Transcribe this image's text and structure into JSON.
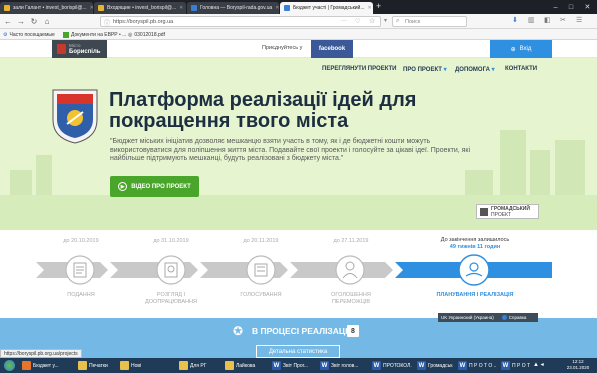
{
  "browser": {
    "tabs": [
      {
        "label": "зали Галант • invest_borispil@...",
        "color": "#e8b42b",
        "active": false
      },
      {
        "label": "Входящие • invest_borispil@...",
        "color": "#e8b42b",
        "active": false
      },
      {
        "label": "Головна — Boryspil-rada.gov.ua",
        "color": "#3b7fd4",
        "active": false
      },
      {
        "label": "Бюджет участі | Громадський...",
        "color": "#3b7fd4",
        "active": true
      }
    ],
    "new_tab": "+",
    "url": "https://boryspil.pb.org.ua",
    "search_placeholder": "Поиск",
    "bookmarks": [
      "Часто посещаемые",
      "Документи на ЕВРР • ...",
      "03012018.pdf"
    ]
  },
  "header": {
    "city_top": "Місто",
    "city_name": "Бориспіль",
    "share_text": "Приєднуйтесь у",
    "facebook_label": "facebook",
    "login_label": "Вхід"
  },
  "menu": {
    "items": [
      "ПЕРЕГЛЯНУТИ ПРОЕКТИ",
      "ПРО ПРОЕКТ",
      "ДОПОМОГА",
      "КОНТАКТИ"
    ]
  },
  "hero": {
    "title": "Платформа реалізації ідей для покращення твого міста",
    "quote": "\"Бюджет міських ініціатив дозволяє мешканцю взяти участь в тому, як і де бюджетні кошти можуть використовуватися для поліпшення життя міста. Подавайте свої проекти і голосуйте за цікаві ідеї. Проекти, які найбільше підтримують мешканці, будуть реалізовані з бюджету міста.\"",
    "video_button": "ВІДЕО ПРО ПРОЕКТ",
    "hromadskyi_logo_1": "ГРОМАДСЬКИЙ",
    "hromadskyi_logo_2": "ПРОЕКТ"
  },
  "timeline": {
    "dates": [
      "до 20.10.2019",
      "до 31.10.2019",
      "до 20.11.2019",
      "до 27.11.2019"
    ],
    "remaining_label": "До закінчення залишилось",
    "remaining_value": "49 тижнів 11 годин",
    "steps": [
      {
        "label": "ПОДАННЯ",
        "active": false
      },
      {
        "label": "РОЗГЛЯД І ДООПРАЦЮВАННЯ",
        "active": false
      },
      {
        "label": "ГОЛОСУВАННЯ",
        "active": false
      },
      {
        "label": "ОГОЛОШЕННЯ ПЕРЕМОЖЦІВ",
        "active": false
      },
      {
        "label": "ПЛАНУВАННЯ І РЕАЛІЗАЦІЯ",
        "active": true
      }
    ]
  },
  "realization": {
    "label": "В ПРОЦЕСІ РЕАЛІЗАЦІЇ",
    "count": "8",
    "stats_button": "Детальна статистика"
  },
  "language_bar": {
    "lang_text": "UK Украинский (Украина)",
    "help_text": "Справка"
  },
  "status_url": "https://boryspil.pb.org.ua/projects",
  "taskbar": {
    "items": [
      {
        "label": "Бюджет у...",
        "color": "#e8732b",
        "glyph": ""
      },
      {
        "label": "Печатки",
        "color": "#e8c04a",
        "glyph": ""
      },
      {
        "label": "Нові",
        "color": "#e8c04a",
        "glyph": ""
      },
      {
        "label": "Для РГ",
        "color": "#e8c04a",
        "glyph": ""
      },
      {
        "label": "Лайкова",
        "color": "#e8c04a",
        "glyph": ""
      },
      {
        "label": "Звіт Прог...",
        "color": "#2b5cab",
        "glyph": "W"
      },
      {
        "label": "Звіт голов...",
        "color": "#2b5cab",
        "glyph": "W"
      },
      {
        "label": "ПРОТОКОЛ...",
        "color": "#2b5cab",
        "glyph": "W"
      },
      {
        "label": "Громадськ...",
        "color": "#2b5cab",
        "glyph": "W"
      },
      {
        "label": "П Р О Т О ...",
        "color": "#2b5cab",
        "glyph": "W"
      },
      {
        "label": "П Р О Т О ...",
        "color": "#2b5cab",
        "glyph": "W"
      }
    ],
    "time": "12:12",
    "date": "23.01.2020"
  }
}
